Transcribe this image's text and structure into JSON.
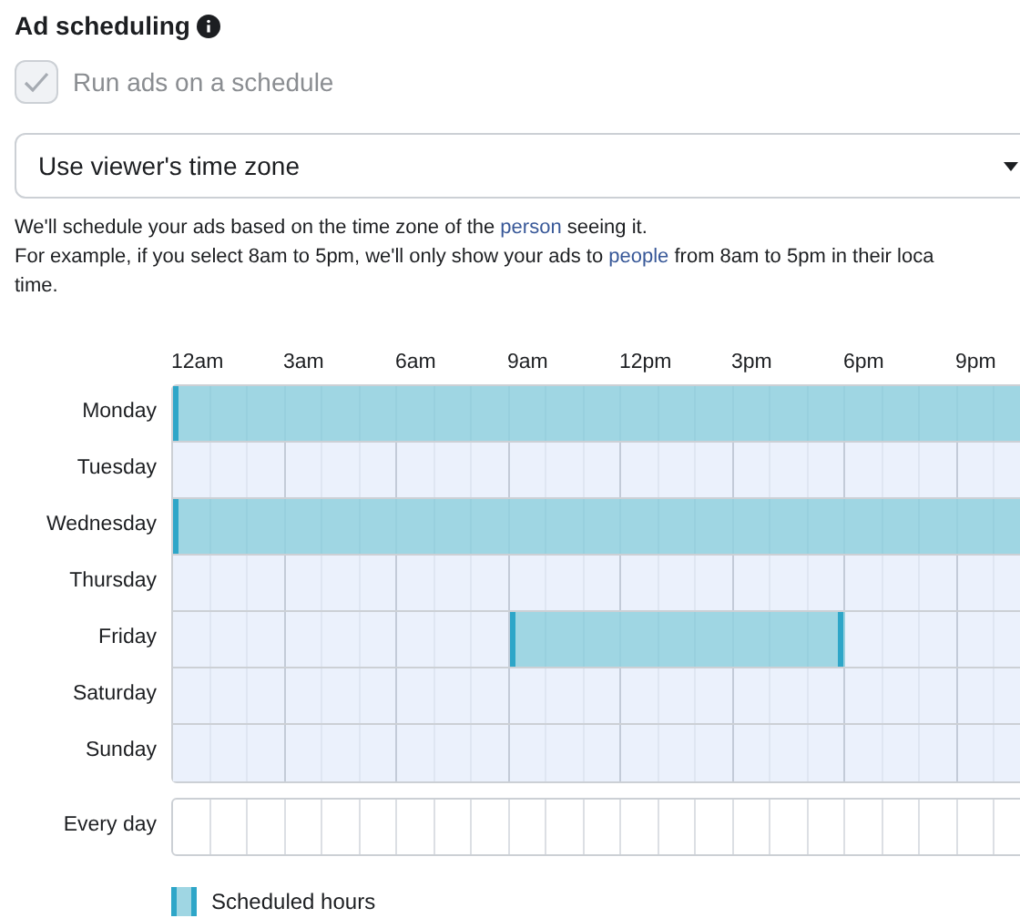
{
  "title": "Ad scheduling",
  "schedule_checkbox": {
    "label": "Run ads on a schedule",
    "checked": true,
    "disabled": true
  },
  "time_zone_select": {
    "value": "Use viewer's time zone"
  },
  "description": [
    [
      {
        "text": "We'll schedule your ads based on the time zone of the "
      },
      {
        "link": "person"
      },
      {
        "text": " seeing it."
      }
    ],
    [
      {
        "text": "For example, if you select 8am to 5pm, we'll only show your ads to "
      },
      {
        "link": "people"
      },
      {
        "text": " from 8am to 5pm in their loca"
      }
    ],
    [
      {
        "text": "time."
      }
    ]
  ],
  "hour_labels": [
    "12am",
    "3am",
    "6am",
    "9am",
    "12pm",
    "3pm",
    "6pm",
    "9pm"
  ],
  "days": [
    {
      "name": "Monday",
      "hours": [
        true,
        true,
        true,
        true,
        true,
        true,
        true,
        true,
        true,
        true,
        true,
        true,
        true,
        true,
        true,
        true,
        true,
        true,
        true,
        true,
        true,
        true,
        true
      ]
    },
    {
      "name": "Tuesday",
      "hours": [
        false,
        false,
        false,
        false,
        false,
        false,
        false,
        false,
        false,
        false,
        false,
        false,
        false,
        false,
        false,
        false,
        false,
        false,
        false,
        false,
        false,
        false,
        false
      ]
    },
    {
      "name": "Wednesday",
      "hours": [
        true,
        true,
        true,
        true,
        true,
        true,
        true,
        true,
        true,
        true,
        true,
        true,
        true,
        true,
        true,
        true,
        true,
        true,
        true,
        true,
        true,
        true,
        true
      ]
    },
    {
      "name": "Thursday",
      "hours": [
        false,
        false,
        false,
        false,
        false,
        false,
        false,
        false,
        false,
        false,
        false,
        false,
        false,
        false,
        false,
        false,
        false,
        false,
        false,
        false,
        false,
        false,
        false
      ]
    },
    {
      "name": "Friday",
      "hours": [
        false,
        false,
        false,
        false,
        false,
        false,
        false,
        false,
        false,
        true,
        true,
        true,
        true,
        true,
        true,
        true,
        true,
        true,
        false,
        false,
        false,
        false,
        false
      ]
    },
    {
      "name": "Saturday",
      "hours": [
        false,
        false,
        false,
        false,
        false,
        false,
        false,
        false,
        false,
        false,
        false,
        false,
        false,
        false,
        false,
        false,
        false,
        false,
        false,
        false,
        false,
        false,
        false
      ]
    },
    {
      "name": "Sunday",
      "hours": [
        false,
        false,
        false,
        false,
        false,
        false,
        false,
        false,
        false,
        false,
        false,
        false,
        false,
        false,
        false,
        false,
        false,
        false,
        false,
        false,
        false,
        false,
        false
      ]
    }
  ],
  "every_day_label": "Every day",
  "legend": "Scheduled hours"
}
